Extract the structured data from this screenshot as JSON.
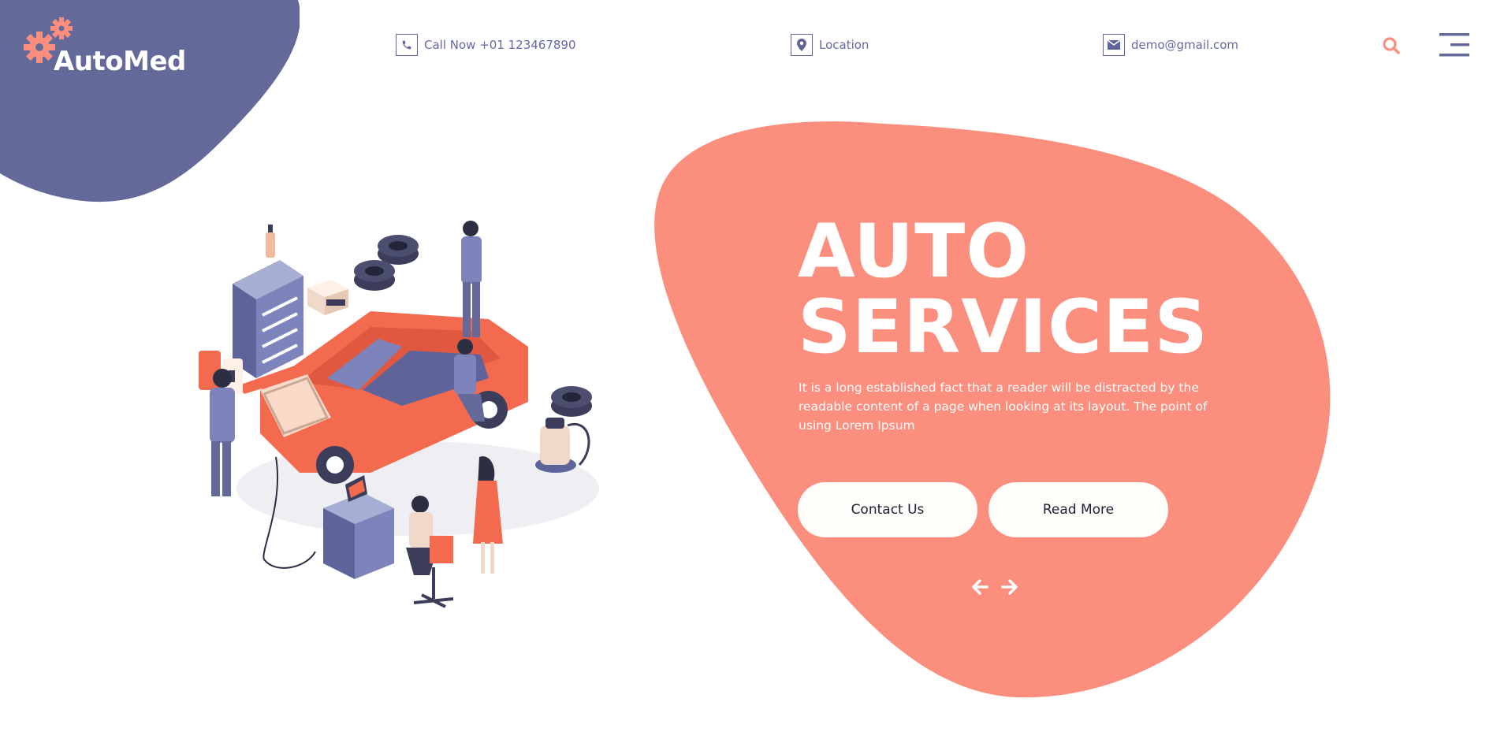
{
  "brand": {
    "name": "AutoMed"
  },
  "header": {
    "phone": {
      "label": "Call Now +01 123467890",
      "icon": "phone-icon"
    },
    "location": {
      "label": "Location",
      "icon": "map-pin-icon"
    },
    "email": {
      "label": "demo@gmail.com",
      "icon": "envelope-icon"
    },
    "search_icon": "search-icon",
    "menu_icon": "hamburger-menu-icon"
  },
  "hero": {
    "title_line1": "AUTO",
    "title_line2": "SERVICES",
    "description": "It is a long established fact that a reader will be distracted by the readable content of a page when looking at its layout. The point of using Lorem Ipsum",
    "buttons": {
      "contact": "Contact Us",
      "read_more": "Read More"
    },
    "prev_icon": "arrow-left-icon",
    "next_icon": "arrow-right-icon"
  },
  "colors": {
    "primary_purple": "#636a9a",
    "accent_coral": "#fc8e7e",
    "button_bg": "#fffdf9"
  }
}
